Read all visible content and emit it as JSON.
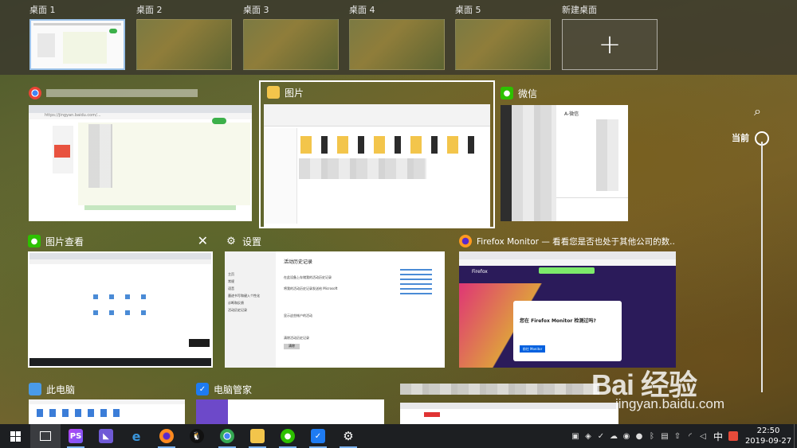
{
  "desktops": [
    {
      "label": "桌面 1"
    },
    {
      "label": "桌面 2"
    },
    {
      "label": "桌面 3"
    },
    {
      "label": "桌面 4"
    },
    {
      "label": "桌面 5"
    }
  ],
  "new_desktop": {
    "label": "新建桌面",
    "plus": "+"
  },
  "windows": {
    "chrome": {
      "title": "",
      "url": "https://jingyan.baidu.com/..."
    },
    "pictures": {
      "title": "图片"
    },
    "wechat": {
      "title": "微信",
      "chat_name": "A-微信"
    },
    "photo_viewer": {
      "title": "图片查看",
      "close": "✕"
    },
    "settings": {
      "title": "设置",
      "heading": "活动历史记录",
      "option1": "在此设备上存储我的活动历史记录",
      "option2": "将我的活动历史记录发送给 Microsoft",
      "section": "显示这些帐户的活动",
      "clear_section": "清除活动历史记录",
      "clear_button": "清除",
      "sidebar_home": "主页",
      "sidebar_items": [
        "常规",
        "语音",
        "墨迹书写和键入个性化",
        "诊断和反馈",
        "活动历史记录"
      ]
    },
    "firefox": {
      "title": "Firefox Monitor — 看看您是否也处于其他公司的数...",
      "brand": "Firefox",
      "dialog_title": "您在 Firefox Monitor 检测过吗?",
      "dialog_button": "前往 Monitor"
    },
    "this_pc": {
      "title": "此电脑"
    },
    "pc_manager": {
      "title": "电脑管家"
    }
  },
  "timeline": {
    "current_label": "当前"
  },
  "watermark": {
    "main": "Bai 经验",
    "sub": "jingyan.baidu.com"
  },
  "taskbar": {
    "clock_time": "22:50",
    "clock_date": "2019-09-27",
    "ime": "中"
  }
}
